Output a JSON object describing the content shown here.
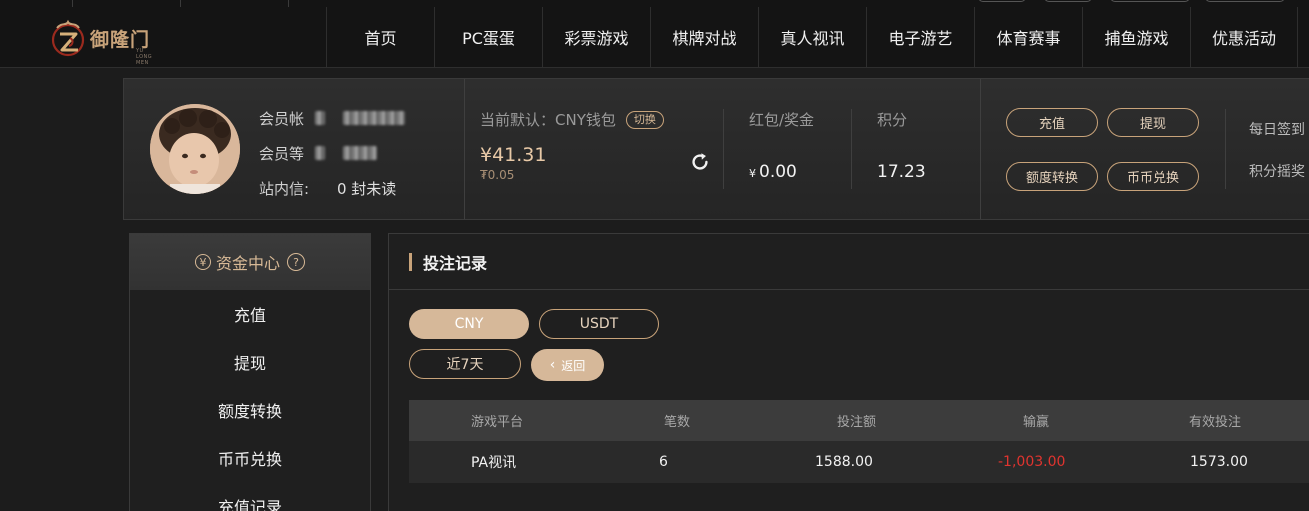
{
  "header": {
    "logo_text": "御隆门",
    "logo_sub": "YU LONG MEN",
    "nav": [
      "首页",
      "PC蛋蛋",
      "彩票游戏",
      "棋牌对战",
      "真人视讯",
      "电子游艺",
      "体育赛事",
      "捕鱼游戏",
      "优惠活动"
    ]
  },
  "member": {
    "account_label": "会员帐",
    "level_label": "会员等",
    "message_label": "站内信:",
    "message_value": "0 封未读",
    "wallet_title": "当前默认：CNY钱包",
    "switch_label": "切换",
    "balance": "¥41.31",
    "sub_balance": "₮0.05",
    "bonus_label": "红包/奖金",
    "bonus_currency": "¥",
    "bonus_value": "0.00",
    "points_label": "积分",
    "points_value": "17.23",
    "actions": {
      "deposit": "充值",
      "withdraw": "提现",
      "transfer": "额度转换",
      "exchange": "币币兑换"
    },
    "daily_signin": "每日签到",
    "points_lottery": "积分摇奖"
  },
  "sidebar": {
    "title": "资金中心",
    "items": [
      "充值",
      "提现",
      "额度转换",
      "币币兑换",
      "充值记录"
    ]
  },
  "main": {
    "title": "投注记录",
    "currency_tabs": [
      "CNY",
      "USDT"
    ],
    "range_label": "近7天",
    "back_label": "返回",
    "columns": [
      "游戏平台",
      "笔数",
      "投注额",
      "输赢",
      "有效投注"
    ],
    "rows": [
      {
        "platform": "PA视讯",
        "count": "6",
        "bet": "1588.00",
        "winloss": "-1,003.00",
        "valid": "1573.00"
      }
    ]
  },
  "colors": {
    "accent": "#c8a37a",
    "accent_fill": "#d6b899",
    "negative": "#e0342f",
    "background": "#1c1c1c"
  }
}
